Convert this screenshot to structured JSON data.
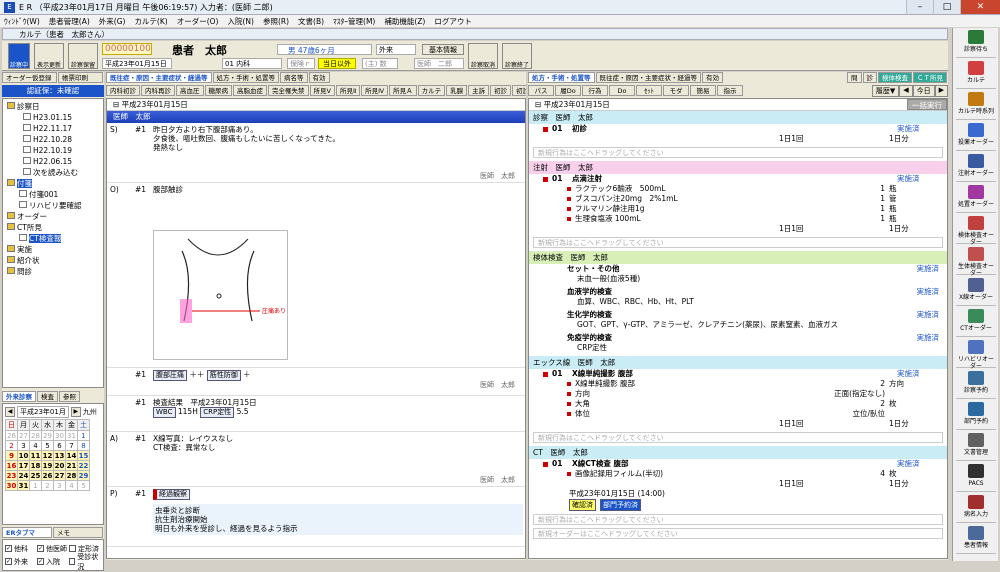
{
  "window": {
    "title": "E R （平成23年01月17日 月曜日 午後06:19:57) 入力者：(医師 二郎)"
  },
  "menu": [
    "ｳｨﾝﾄﾞｳ(W)",
    "患者管理(A)",
    "外来(G)",
    "カルテ(K)",
    "オーダー(O)",
    "入院(N)",
    "参照(R)",
    "文書(B)",
    "ﾏｽﾀｰ管理(M)",
    "補助機能(Z)",
    "ログアウト"
  ],
  "karte": {
    "window_label": "カルテ（患者　太郎さん）",
    "btn_exam": "診察中",
    "btn_refresh": "表示更新",
    "btn_hold": "診察保留",
    "btn_cancel": "診察取消",
    "btn_end": "診察終了"
  },
  "patient": {
    "id": "00000100",
    "name": "患者　太郎",
    "sex_age": "男 47歳6ヶ月",
    "dept_select": "外来",
    "info_btn": "基本情報",
    "date": "平成23年01月15日",
    "ward": "01 内科",
    "insurance": "保険ｒ",
    "today_btn": "当日以外",
    "main": "(主) 数",
    "doctor": "医師　二郎"
  },
  "left": {
    "tabs": [
      "オーダー仮登録",
      "帳票印刷"
    ],
    "header": "認証保：未確認",
    "tree": [
      "診察日",
      "H23.01.15",
      "H22.11.17",
      "H22.10.28",
      "H22.10.19",
      "H22.06.15",
      "次を読み込む",
      "付箋",
      "付箋001",
      "リハビリ要確認",
      "オーダー",
      "CT所見",
      "CT検査報",
      "実施",
      "紹介状",
      "問診"
    ],
    "cal_tabs": [
      "外来診察",
      "検査",
      "参照"
    ],
    "cal_month": "平成23年01月",
    "cal_nav": "九州",
    "weekdays": [
      "日",
      "月",
      "火",
      "水",
      "木",
      "金",
      "土"
    ],
    "days": [
      [
        "26",
        "27",
        "28",
        "29",
        "30",
        "31",
        "1"
      ],
      [
        "2",
        "3",
        "4",
        "5",
        "6",
        "7",
        "8"
      ],
      [
        "9",
        "10",
        "11",
        "12",
        "13",
        "14",
        "15"
      ],
      [
        "16",
        "17",
        "18",
        "19",
        "20",
        "21",
        "22"
      ],
      [
        "23",
        "24",
        "25",
        "26",
        "27",
        "28",
        "29"
      ],
      [
        "30",
        "31",
        "1",
        "2",
        "3",
        "4",
        "5"
      ]
    ],
    "bottom_tabs": [
      "ERタブマ",
      "メモ"
    ],
    "checks": [
      "他科",
      "他医師",
      "定形済",
      "外来",
      "入院",
      "受診状況"
    ]
  },
  "soap": {
    "tabs": [
      "既往症・原因・主要症状・経過等",
      "処方・手術・処置等",
      "病名等",
      "有効"
    ],
    "subtabs": [
      "内科初診",
      "内科再診",
      "高血圧",
      "糖尿病",
      "高脂血症",
      "完全罹失禁",
      "所見Ⅴ",
      "所見Ⅱ",
      "所見Ⅳ",
      "所見Ａ",
      "カルテ",
      "乳腺",
      "主訴",
      "初診",
      "初診"
    ],
    "date": "平成23年01月15日",
    "doctor_bar": "医師　太郎",
    "s_label": "S)",
    "s_num": "#1",
    "s_text": [
      "昨日夕方より右下腹部痛あり。",
      "夕食後、嘔吐数回、腹痛もしたいに苦しくなってきた。",
      "発熱なし"
    ],
    "doctor_sign": "医師　太郎",
    "o_label": "O)",
    "o_num": "#1",
    "o_text": "腹部触診",
    "figure_label": "圧痛あり",
    "o2_num": "#1",
    "o2_chip1": "腹部圧痛",
    "o2_plus": "＋＋",
    "o2_chip2": "筋性防御",
    "o2_plus2": "＋",
    "o3_num": "#1",
    "o3_text": "検査結果　平成23年01月15日",
    "o3_wbc": "WBC",
    "o3_wbc_val": "115H",
    "o3_crp": "CRP定性",
    "o3_crp_val": "5.5",
    "a_label": "A)",
    "a_num": "#1",
    "a_text": [
      "X線写真：レイウスなし",
      "CT検査：異常なし"
    ],
    "p_label": "P)",
    "p_num": "#1",
    "p_chip": "経過観察",
    "p_text": [
      "虫垂炎と診断",
      "抗生剤治療開始",
      "明日も外来を受診し、経過を見るよう指示"
    ]
  },
  "orders": {
    "tabs": [
      "処方・手術・処置等",
      "既往症・原因・主要症状・経過等",
      "有効"
    ],
    "right_tabs": [
      "問",
      "診",
      "検体検査",
      "ＣＴ所見"
    ],
    "subtabs": [
      "パス",
      "履Do",
      "行為",
      "Do",
      "ｾｯﾄ",
      "モダ",
      "簡易",
      "指示"
    ],
    "history": "履歴▼",
    "nav": "今日",
    "date": "平成23年01月15日",
    "stamp": "一括実行",
    "blocks": [
      {
        "title": "診察　医師　太郎",
        "color": "#c9ecf5",
        "items": [
          {
            "num": "01",
            "name": "初診",
            "status": "実施済",
            "qty": "1日1回",
            "days": "1日分"
          }
        ],
        "subs": []
      },
      {
        "title": "注射　医師　太郎",
        "color": "#f8d0ec",
        "items": [
          {
            "num": "01",
            "name": "点滴注射",
            "status": "実施済"
          }
        ],
        "subs": [
          [
            "ラクテック6輸液　500mL",
            "1",
            "瓶"
          ],
          [
            "ブスコパン注20mg　2%1mL",
            "1",
            "管"
          ],
          [
            "フルマリン静注用1g",
            "1",
            "瓶"
          ],
          [
            "生理食塩液 100mL",
            "1",
            "瓶"
          ]
        ],
        "qty": "1日1回",
        "days": "1日分"
      },
      {
        "title": "検体検査　医師　太郎",
        "color": "#d8f0b8",
        "groups": [
          [
            "セット・その他",
            "実施済",
            "末血一般(血液5種)"
          ],
          [
            "血液学的検査",
            "実施済",
            "血算、WBC、RBC、Hb、Ht、PLT"
          ],
          [
            "生化学的検査",
            "実施済",
            "GOT、GPT、γ-GTP、アミラーゼ、クレアチニン(薬尿)、尿素窒素、血液ガス"
          ],
          [
            "免疫学的検査",
            "実施済",
            "CRP定性"
          ]
        ]
      },
      {
        "title": "エックス線　医師　太郎",
        "color": "#c9ecf5",
        "items": [
          {
            "num": "01",
            "name": "X線単純撮影 腹部",
            "status": "実施済"
          }
        ],
        "subs": [
          [
            "X線単純撮影 腹部",
            "2",
            "方向"
          ],
          [
            "方向",
            "正面(指定なし)",
            ""
          ],
          [
            "大角",
            "2",
            "枚"
          ],
          [
            "体位",
            "立位/臥位",
            ""
          ]
        ],
        "qty": "1日1回",
        "days": "1日分"
      },
      {
        "title": "CT　医師　太郎",
        "color": "#c9ecf5",
        "items": [
          {
            "num": "01",
            "name": "X線CT検査 腹部",
            "status": "実施済"
          }
        ],
        "subs": [
          [
            "画像記録用フィルム(半切)",
            "4",
            "枚"
          ]
        ],
        "qty": "1日1回",
        "days": "1日分",
        "note": "平成23年01月15日 (14:00)",
        "chips": [
          "確認済",
          "部門予約済"
        ]
      }
    ],
    "drop_text": "新規行為はここへドラッグしてください",
    "drop_order": "新規オーダーはここへドラッグしてください"
  },
  "sidebar": [
    "診察待ち",
    "カルテ",
    "カルテ時系列",
    "投薬オーダー",
    "注射オーダー",
    "処置オーダー",
    "検体検査オーダー",
    "生体検査オーダー",
    "X線オーダー",
    "CTオーダー",
    "リハビリオーダー",
    "診察予約",
    "部門予約",
    "文書管理",
    "PACS",
    "病名入力",
    "患者情報"
  ]
}
